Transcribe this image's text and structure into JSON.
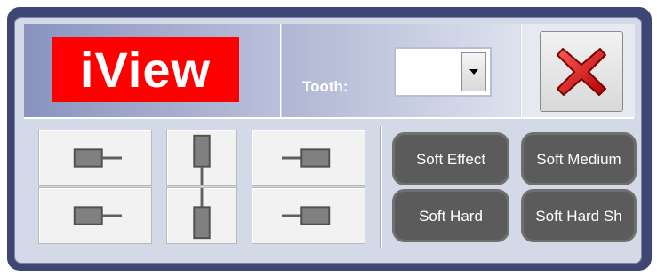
{
  "header": {
    "logo_text": "iView",
    "tooth_label": "Tooth:",
    "tooth_value": ""
  },
  "sensor_buttons": [
    {
      "name": "horizontal-cable-right-top",
      "icon": "sensor-cable-right-icon"
    },
    {
      "name": "vertical-cable-down",
      "icon": "sensor-cable-down-icon"
    },
    {
      "name": "horizontal-cable-left-top",
      "icon": "sensor-cable-left-icon"
    },
    {
      "name": "horizontal-cable-right-bottom",
      "icon": "sensor-cable-right-icon"
    },
    {
      "name": "vertical-cable-up",
      "icon": "sensor-cable-up-icon"
    },
    {
      "name": "horizontal-cable-left-bottom",
      "icon": "sensor-cable-left-icon"
    }
  ],
  "filters": {
    "soft_effect": "Soft Effect",
    "soft_medium": "Soft Medium",
    "soft_hard": "Soft Hard",
    "soft_hard_sh": "Soft Hard Sh"
  },
  "colors": {
    "frame": "#3e4674",
    "logo_bg": "#ff0000",
    "filter_button_bg": "#5b5b5b",
    "close_x": "#d01818"
  }
}
